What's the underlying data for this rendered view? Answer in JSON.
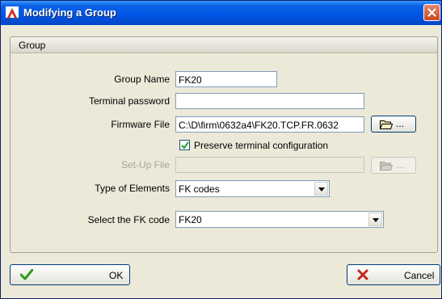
{
  "window": {
    "title": "Modifying a Group"
  },
  "group": {
    "header": "Group"
  },
  "form": {
    "group_name_label": "Group Name",
    "group_name_value": "FK20",
    "terminal_password_label": "Terminal password",
    "terminal_password_value": "",
    "firmware_file_label": "Firmware File",
    "firmware_file_value": "C:\\D\\firm\\0632a4\\FK20.TCP.FR.0632",
    "browse_label": "...",
    "preserve_label": "Preserve terminal configuration",
    "preserve_checked": true,
    "setup_file_label": "Set-Up File",
    "setup_file_value": "",
    "type_of_elements_label": "Type of Elements",
    "type_of_elements_value": "FK codes",
    "select_fk_label": "Select the FK code",
    "select_fk_value": "FK20"
  },
  "buttons": {
    "ok_label": "OK",
    "cancel_label": "Cancel"
  },
  "colors": {
    "ok_check": "#2e9a1e",
    "cancel_x": "#c0281a",
    "title_bar": "#0054e3"
  }
}
